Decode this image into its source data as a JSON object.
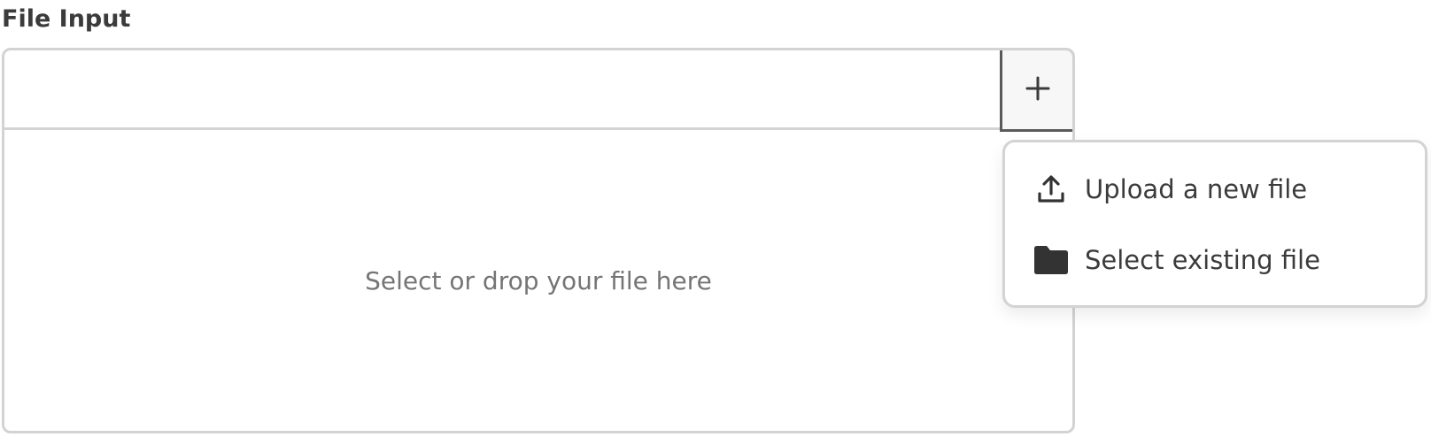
{
  "field": {
    "label": "File Input"
  },
  "file_input": {
    "dropzone_text": "Select or drop your file here",
    "add_button_icon": "plus-icon"
  },
  "menu": {
    "items": [
      {
        "label": "Upload a new file",
        "icon": "upload-icon"
      },
      {
        "label": "Select existing file",
        "icon": "folder-icon"
      }
    ]
  },
  "colors": {
    "border": "#d3d3d3",
    "active_border": "#5a5a5a",
    "text": "#3b3b3b",
    "muted_text": "#757575",
    "button_bg": "#f7f7f7"
  }
}
